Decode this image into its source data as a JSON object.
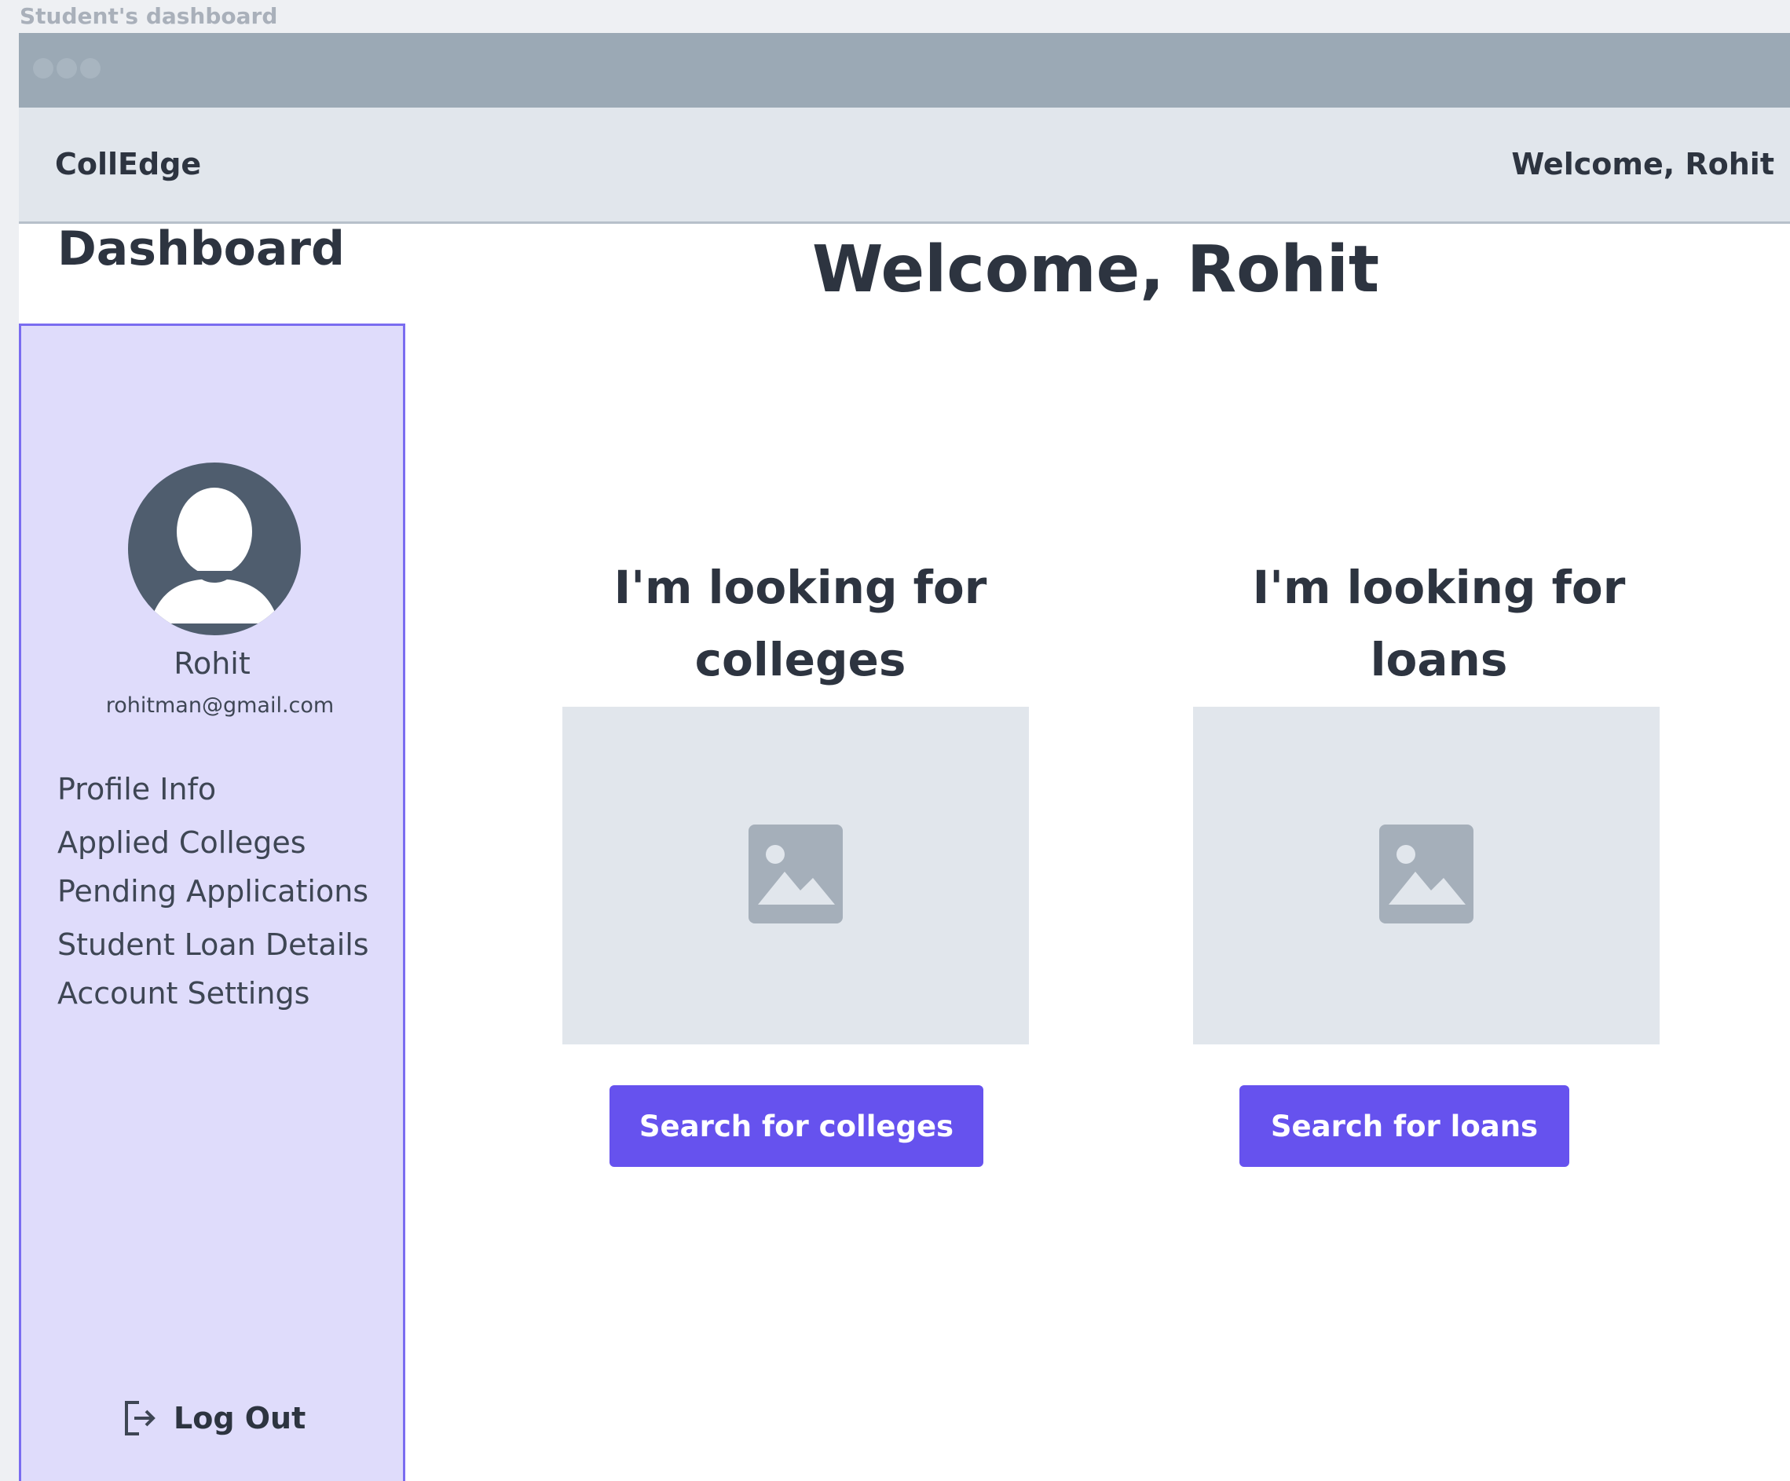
{
  "frame": {
    "label": "Student's dashboard"
  },
  "appbar": {
    "brand": "CollEdge",
    "welcome": "Welcome, Rohit"
  },
  "sidebar": {
    "title": "Dashboard",
    "user": {
      "name": "Rohit",
      "email": "rohitman@gmail.com"
    },
    "nav": [
      {
        "label": "Profile Info"
      },
      {
        "label": "Applied Colleges"
      },
      {
        "label": "Pending Applications"
      },
      {
        "label": "Student Loan Details"
      },
      {
        "label": "Account Settings"
      }
    ],
    "logout": {
      "label": "Log Out"
    }
  },
  "main": {
    "title": "Welcome, Rohit",
    "cards": [
      {
        "heading_line1": "I'm looking for",
        "heading_line2": "colleges",
        "button": "Search for colleges",
        "image_icon": "image-placeholder-icon"
      },
      {
        "heading_line1": "I'm looking for",
        "heading_line2": "loans",
        "button": "Search for loans",
        "image_icon": "image-placeholder-icon"
      }
    ]
  },
  "colors": {
    "accent": "#6652ee",
    "sidebar_bg": "#dfdcfb",
    "sidebar_border": "#7a6cf0",
    "appbar_bg": "#e1e6ec",
    "titlebar_bg": "#9ba9b5"
  }
}
